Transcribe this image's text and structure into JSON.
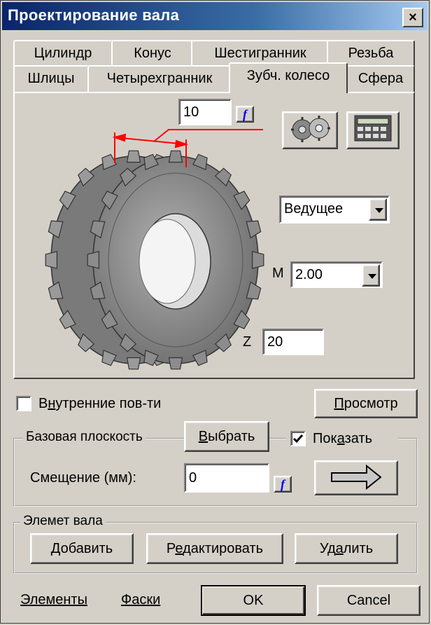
{
  "window": {
    "title": "Проектирование вала",
    "close_glyph": "×"
  },
  "tabs": {
    "row1": [
      "Цилиндр",
      "Конус",
      "Шестигранник",
      "Резьба"
    ],
    "row2": [
      "Шлицы",
      "Четырехгранник",
      "Зубч. колесо",
      "Сфера"
    ],
    "active": "Зубч. колесо"
  },
  "gear_panel": {
    "dimension_value": "10",
    "f_label": "f",
    "type_value": "Ведущее",
    "module_label": "M",
    "module_value": "2.00",
    "teeth_label": "Z",
    "teeth_value": "20",
    "icons": [
      "gear-pair-icon",
      "calculator-icon"
    ]
  },
  "internal_surfaces": {
    "checked": false,
    "label_prefix": "В",
    "label_underlined": "н",
    "label_suffix": "утренние пов-ти"
  },
  "preview_button": {
    "underlined": "П",
    "rest": "росмотр"
  },
  "base_plane": {
    "label": "Базовая плоскость",
    "select_button_underlined": "В",
    "select_button_rest": "ыбрать",
    "show_checked": true,
    "show_prefix": "Пок",
    "show_underlined": "а",
    "show_suffix": "зать",
    "offset_label": "Смещение (мм):",
    "offset_value": "0",
    "f_label": "f",
    "direction_icon": "right-arrow-icon"
  },
  "shaft_element": {
    "label": "Элемет вала",
    "add_underlined": "Д",
    "add_rest": "обавить",
    "edit_prefix": "Р",
    "edit_underlined": "е",
    "edit_rest": "дактировать",
    "delete_prefix": "Уд",
    "delete_underlined": "а",
    "delete_rest": "лить"
  },
  "footer": {
    "elements_link": "Элементы",
    "chamfers_link": "Фаски",
    "ok_label": "OK",
    "cancel_label": "Cancel"
  },
  "colors": {
    "titlebar_start": "#0a246a",
    "titlebar_end": "#a6caf0",
    "face": "#d4d0c8",
    "dimension_line": "#ff0000",
    "gear": "#8c8c8c"
  }
}
